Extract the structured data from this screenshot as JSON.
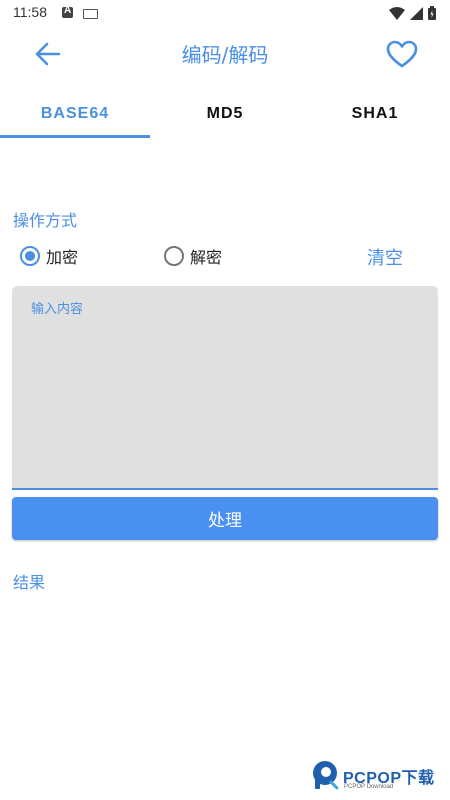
{
  "status_bar": {
    "time": "11:58"
  },
  "app_bar": {
    "title": "编码/解码"
  },
  "tabs": [
    {
      "label": "BASE64",
      "active": true
    },
    {
      "label": "MD5",
      "active": false
    },
    {
      "label": "SHA1",
      "active": false
    }
  ],
  "operation": {
    "label": "操作方式",
    "options": [
      {
        "label": "加密",
        "checked": true
      },
      {
        "label": "解密",
        "checked": false
      }
    ],
    "clear_label": "清空"
  },
  "input": {
    "placeholder": "输入内容",
    "value": ""
  },
  "process_button": {
    "label": "处理"
  },
  "result": {
    "label": "结果",
    "value": ""
  },
  "watermark": {
    "brand": "PCPOP下载",
    "sub": "PCPOP Download"
  },
  "colors": {
    "accent": "#4a90e2",
    "button": "#4a90f0",
    "input_bg": "#e0e0e0"
  }
}
